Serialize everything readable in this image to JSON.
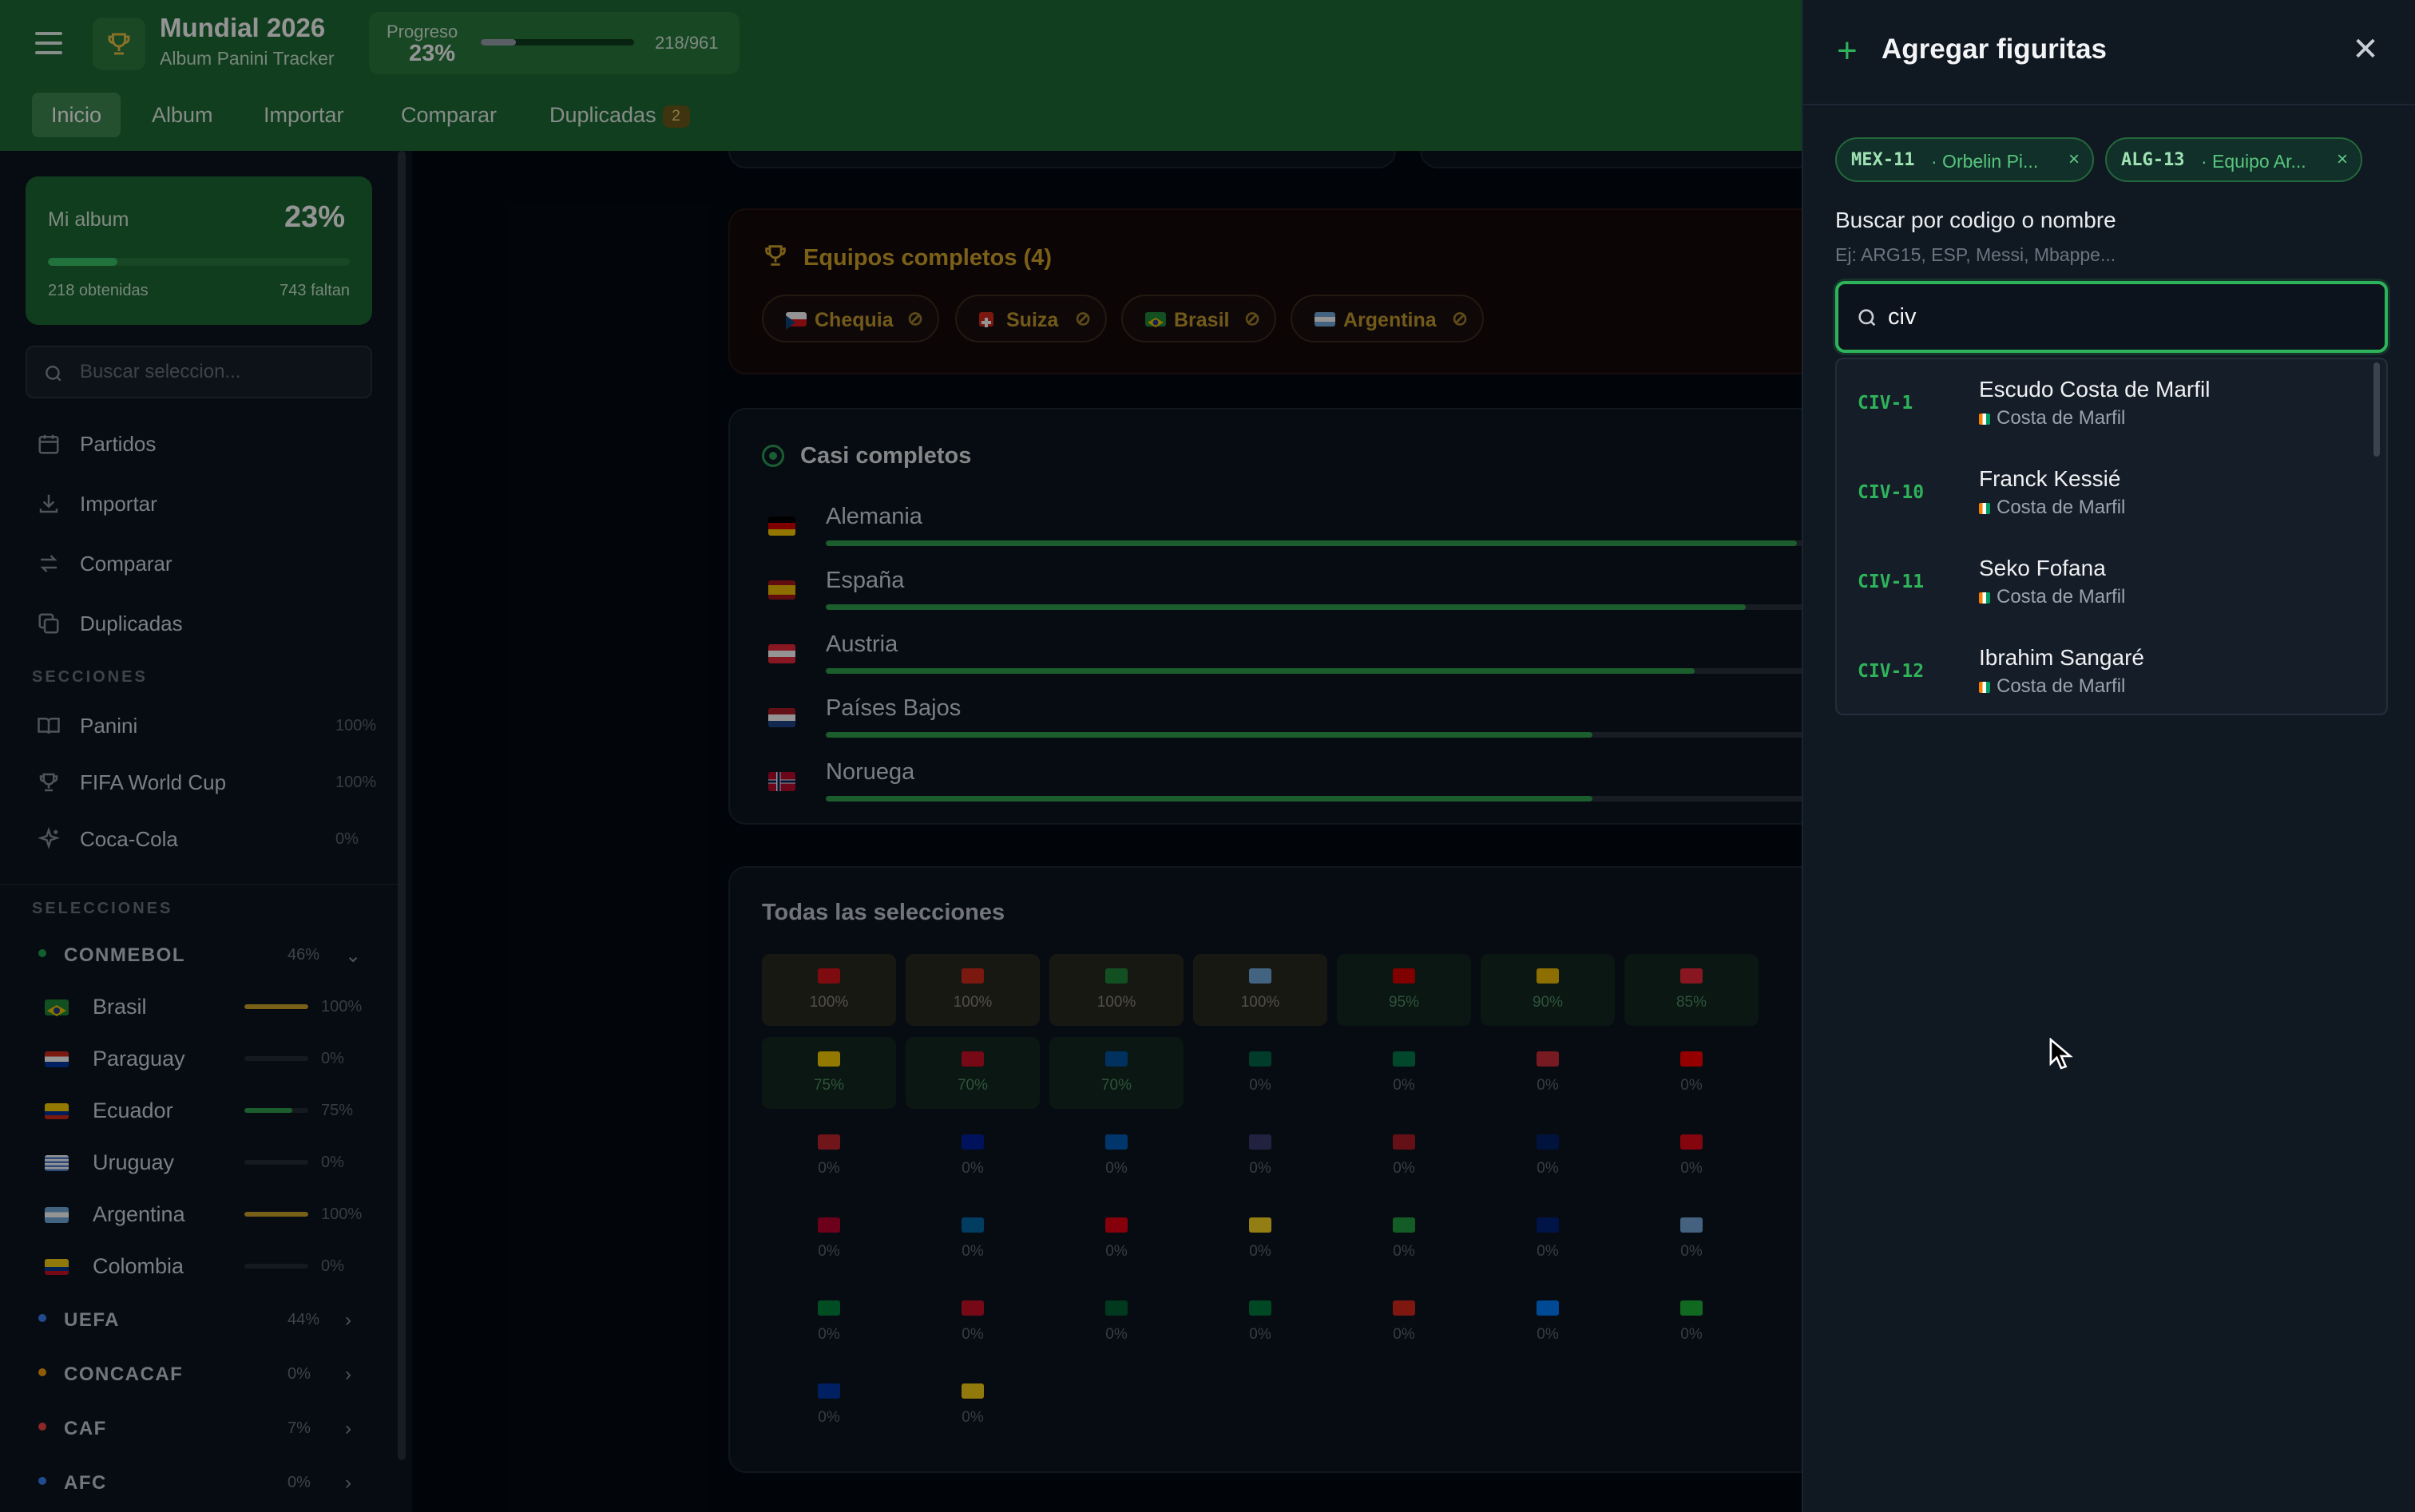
{
  "header": {
    "app_title": "Mundial 2026",
    "app_subtitle": "Album Panini Tracker",
    "progress_label": "Progreso",
    "progress_pct": "23%",
    "progress_value": 0.23,
    "progress_count": "218/961",
    "tabs": [
      {
        "label": "Inicio",
        "active": true
      },
      {
        "label": "Album"
      },
      {
        "label": "Importar"
      },
      {
        "label": "Comparar"
      },
      {
        "label": "Duplicadas",
        "badge": "2"
      }
    ]
  },
  "sidebar": {
    "album_card": {
      "title": "Mi album",
      "pct": "23%",
      "value": 0.23,
      "obtenidas": "218 obtenidas",
      "faltan": "743 faltan"
    },
    "search_placeholder": "Buscar seleccion...",
    "nav": [
      {
        "label": "Partidos",
        "icon": "calendar-icon"
      },
      {
        "label": "Importar",
        "icon": "download-icon"
      },
      {
        "label": "Comparar",
        "icon": "swap-icon"
      },
      {
        "label": "Duplicadas",
        "icon": "copy-icon"
      }
    ],
    "secciones_header": "SECCIONES",
    "secciones": [
      {
        "label": "Panini",
        "pct": "100%",
        "icon": "book-icon"
      },
      {
        "label": "FIFA World Cup",
        "pct": "100%",
        "icon": "trophy-icon"
      },
      {
        "label": "Coca-Cola",
        "pct": "0%",
        "icon": "sparkle-icon"
      }
    ],
    "selecciones_header": "SELECCIONES",
    "confederations": [
      {
        "label": "CONMEBOL",
        "pct": "46%",
        "color": "#22a24f",
        "expanded": true,
        "teams": [
          {
            "label": "Brasil",
            "pct": "100%",
            "value": 1.0,
            "bar_color": "#d1a52b"
          },
          {
            "label": "Paraguay",
            "pct": "0%",
            "value": 0,
            "bar_color": "#d1a52b"
          },
          {
            "label": "Ecuador",
            "pct": "75%",
            "value": 0.75,
            "bar_color": "#2fa14f"
          },
          {
            "label": "Uruguay",
            "pct": "0%",
            "value": 0,
            "bar_color": "#d1a52b"
          },
          {
            "label": "Argentina",
            "pct": "100%",
            "value": 1.0,
            "bar_color": "#d1a52b"
          },
          {
            "label": "Colombia",
            "pct": "0%",
            "value": 0,
            "bar_color": "#d1a52b"
          }
        ]
      },
      {
        "label": "UEFA",
        "pct": "44%",
        "color": "#3b82f6"
      },
      {
        "label": "CONCACAF",
        "pct": "0%",
        "color": "#f59e0b"
      },
      {
        "label": "CAF",
        "pct": "7%",
        "color": "#ef4444"
      },
      {
        "label": "AFC",
        "pct": "0%",
        "color": "#3b82f6"
      }
    ]
  },
  "main": {
    "equipos_title": "Equipos completos (4)",
    "equipos": [
      {
        "label": "Chequia"
      },
      {
        "label": "Suiza"
      },
      {
        "label": "Brasil"
      },
      {
        "label": "Argentina"
      }
    ],
    "casi_title": "Casi completos",
    "casi": [
      {
        "label": "Alemania",
        "value": 0.95
      },
      {
        "label": "España",
        "value": 0.9
      },
      {
        "label": "Austria",
        "value": 0.85
      },
      {
        "label": "Países Bajos",
        "value": 0.75
      },
      {
        "label": "Noruega",
        "value": 0.75
      }
    ],
    "todas_title": "Todas las selecciones",
    "todas": [
      "100%",
      "100%",
      "100%",
      "100%",
      "95%",
      "90%",
      "85%",
      "75%",
      "70%",
      "70%",
      "0%",
      "0%",
      "0%",
      "0%",
      "0%",
      "0%",
      "0%",
      "0%",
      "0%",
      "0%",
      "0%",
      "0%",
      "0%",
      "0%",
      "0%",
      "0%",
      "0%",
      "0%",
      "0%",
      "0%",
      "0%",
      "0%",
      "0%",
      "0%",
      "0%",
      "0%",
      "0%"
    ]
  },
  "drawer": {
    "title": "Agregar figuritas",
    "selected": [
      {
        "code": "MEX-11",
        "name": "· Orbelin Pi..."
      },
      {
        "code": "ALG-13",
        "name": "· Equipo Ar..."
      }
    ],
    "search_label": "Buscar por codigo o nombre",
    "search_hint": "Ej: ARG15, ESP, Messi, Mbappe...",
    "search_value": "civ",
    "results": [
      {
        "code": "CIV-1",
        "name": "Escudo Costa de Marfil",
        "team": "Costa de Marfil"
      },
      {
        "code": "CIV-10",
        "name": "Franck Kessié",
        "team": "Costa de Marfil"
      },
      {
        "code": "CIV-11",
        "name": "Seko Fofana",
        "team": "Costa de Marfil"
      },
      {
        "code": "CIV-12",
        "name": "Ibrahim Sangaré",
        "team": "Costa de Marfil"
      }
    ]
  },
  "colors": {
    "accent": "#2fb35a",
    "header_green": "#1d6b35",
    "gold": "#d4a62a"
  }
}
